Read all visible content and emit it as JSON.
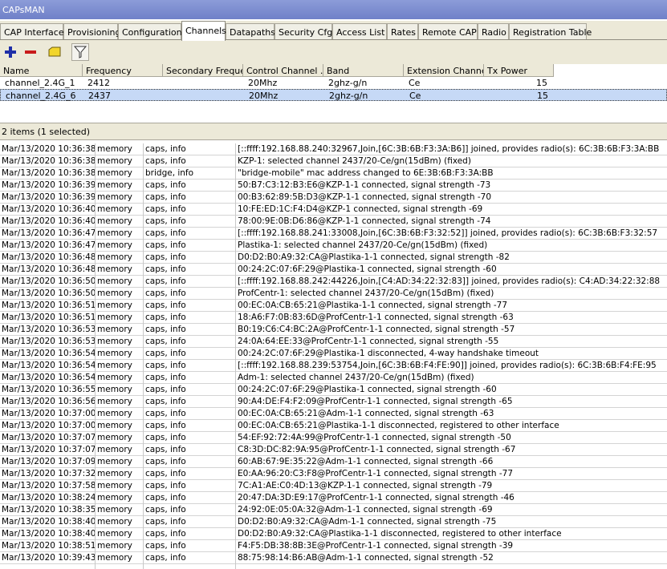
{
  "window": {
    "title": "CAPsMAN"
  },
  "tabs": [
    "CAP Interface",
    "Provisioning",
    "Configurations",
    "Channels",
    "Datapaths",
    "Security Cfg.",
    "Access List",
    "Rates",
    "Remote CAP",
    "Radio",
    "Registration Table"
  ],
  "active_tab": "Channels",
  "toolbar": {
    "buttons": [
      "add-icon",
      "remove-icon",
      "comment-icon",
      "filter-icon"
    ]
  },
  "grid": {
    "columns": [
      "Name",
      "Frequency",
      "Secondary Freque...",
      "Control Channel ...",
      "Band",
      "Extension Channel",
      "Tx Power"
    ],
    "rows": [
      {
        "name": "channel_2.4G_1",
        "frequency": "2412",
        "secondary": "",
        "control": "20Mhz",
        "band": "2ghz-g/n",
        "extension": "Ce",
        "tx_power": "15"
      },
      {
        "name": "channel_2.4G_6",
        "frequency": "2437",
        "secondary": "",
        "control": "20Mhz",
        "band": "2ghz-g/n",
        "extension": "Ce",
        "tx_power": "15"
      }
    ],
    "status": "2 items (1 selected)"
  },
  "log": [
    [
      "Mar/13/2020 10:36:38",
      "memory",
      "caps, info",
      "[::ffff:192.168.88.240:32967,Join,[6C:3B:6B:F3:3A:B6]] joined, provides radio(s): 6C:3B:6B:F3:3A:BB"
    ],
    [
      "Mar/13/2020 10:36:38",
      "memory",
      "caps, info",
      "KZP-1: selected channel 2437/20-Ce/gn(15dBm) (fixed)"
    ],
    [
      "Mar/13/2020 10:36:38",
      "memory",
      "bridge, info",
      "\"bridge-mobile\" mac address changed to 6E:3B:6B:F3:3A:BB"
    ],
    [
      "Mar/13/2020 10:36:39",
      "memory",
      "caps, info",
      "50:B7:C3:12:B3:E6@KZP-1-1 connected, signal strength -73"
    ],
    [
      "Mar/13/2020 10:36:39",
      "memory",
      "caps, info",
      "00:B3:62:89:5B:D3@KZP-1-1 connected, signal strength -70"
    ],
    [
      "Mar/13/2020 10:36:40",
      "memory",
      "caps, info",
      "10:FE:ED:1C:F4:D4@KZP-1 connected, signal strength -69"
    ],
    [
      "Mar/13/2020 10:36:40",
      "memory",
      "caps, info",
      "78:00:9E:0B:D6:86@KZP-1-1 connected, signal strength -74"
    ],
    [
      "Mar/13/2020 10:36:47",
      "memory",
      "caps, info",
      "[::ffff:192.168.88.241:33008,Join,[6C:3B:6B:F3:32:52]] joined, provides radio(s): 6C:3B:6B:F3:32:57"
    ],
    [
      "Mar/13/2020 10:36:47",
      "memory",
      "caps, info",
      "Plastika-1: selected channel 2437/20-Ce/gn(15dBm) (fixed)"
    ],
    [
      "Mar/13/2020 10:36:48",
      "memory",
      "caps, info",
      "D0:D2:B0:A9:32:CA@Plastika-1-1 connected, signal strength -82"
    ],
    [
      "Mar/13/2020 10:36:48",
      "memory",
      "caps, info",
      "00:24:2C:07:6F:29@Plastika-1 connected, signal strength -60"
    ],
    [
      "Mar/13/2020 10:36:50",
      "memory",
      "caps, info",
      "[::ffff:192.168.88.242:44226,Join,[C4:AD:34:22:32:83]] joined, provides radio(s): C4:AD:34:22:32:88"
    ],
    [
      "Mar/13/2020 10:36:50",
      "memory",
      "caps, info",
      "ProfCentr-1: selected channel 2437/20-Ce/gn(15dBm) (fixed)"
    ],
    [
      "Mar/13/2020 10:36:51",
      "memory",
      "caps, info",
      "00:EC:0A:CB:65:21@Plastika-1-1 connected, signal strength -77"
    ],
    [
      "Mar/13/2020 10:36:51",
      "memory",
      "caps, info",
      "18:A6:F7:0B:83:6D@ProfCentr-1-1 connected, signal strength -63"
    ],
    [
      "Mar/13/2020 10:36:53",
      "memory",
      "caps, info",
      "B0:19:C6:C4:BC:2A@ProfCentr-1-1 connected, signal strength -57"
    ],
    [
      "Mar/13/2020 10:36:53",
      "memory",
      "caps, info",
      "24:0A:64:EE:33@ProfCentr-1-1 connected, signal strength -55"
    ],
    [
      "Mar/13/2020 10:36:54",
      "memory",
      "caps, info",
      "00:24:2C:07:6F:29@Plastika-1 disconnected, 4-way handshake timeout"
    ],
    [
      "Mar/13/2020 10:36:54",
      "memory",
      "caps, info",
      "[::ffff:192.168.88.239:53754,Join,[6C:3B:6B:F4:FE:90]] joined, provides radio(s): 6C:3B:6B:F4:FE:95"
    ],
    [
      "Mar/13/2020 10:36:54",
      "memory",
      "caps, info",
      "Adm-1: selected channel 2437/20-Ce/gn(15dBm) (fixed)"
    ],
    [
      "Mar/13/2020 10:36:55",
      "memory",
      "caps, info",
      "00:24:2C:07:6F:29@Plastika-1 connected, signal strength -60"
    ],
    [
      "Mar/13/2020 10:36:56",
      "memory",
      "caps, info",
      "90:A4:DE:F4:F2:09@ProfCentr-1-1 connected, signal strength -65"
    ],
    [
      "Mar/13/2020 10:37:00",
      "memory",
      "caps, info",
      "00:EC:0A:CB:65:21@Adm-1-1 connected, signal strength -63"
    ],
    [
      "Mar/13/2020 10:37:00",
      "memory",
      "caps, info",
      "00:EC:0A:CB:65:21@Plastika-1-1 disconnected, registered to other interface"
    ],
    [
      "Mar/13/2020 10:37:07",
      "memory",
      "caps, info",
      "54:EF:92:72:4A:99@ProfCentr-1-1 connected, signal strength -50"
    ],
    [
      "Mar/13/2020 10:37:07",
      "memory",
      "caps, info",
      "C8:3D:DC:82:9A:95@ProfCentr-1-1 connected, signal strength -67"
    ],
    [
      "Mar/13/2020 10:37:09",
      "memory",
      "caps, info",
      "60:AB:67:9E:35:22@Adm-1-1 connected, signal strength -66"
    ],
    [
      "Mar/13/2020 10:37:32",
      "memory",
      "caps, info",
      "E0:AA:96:20:C3:F8@ProfCentr-1-1 connected, signal strength -77"
    ],
    [
      "Mar/13/2020 10:37:58",
      "memory",
      "caps, info",
      "7C:A1:AE:C0:4D:13@KZP-1-1 connected, signal strength -79"
    ],
    [
      "Mar/13/2020 10:38:24",
      "memory",
      "caps, info",
      "20:47:DA:3D:E9:17@ProfCentr-1-1 connected, signal strength -46"
    ],
    [
      "Mar/13/2020 10:38:35",
      "memory",
      "caps, info",
      "24:92:0E:05:0A:32@Adm-1-1 connected, signal strength -69"
    ],
    [
      "Mar/13/2020 10:38:40",
      "memory",
      "caps, info",
      "D0:D2:B0:A9:32:CA@Adm-1-1 connected, signal strength -75"
    ],
    [
      "Mar/13/2020 10:38:40",
      "memory",
      "caps, info",
      "D0:D2:B0:A9:32:CA@Plastika-1-1 disconnected, registered to other interface"
    ],
    [
      "Mar/13/2020 10:38:51",
      "memory",
      "caps, info",
      "F4:F5:DB:38:8B:3E@ProfCentr-1-1 connected, signal strength -39"
    ],
    [
      "Mar/13/2020 10:39:43",
      "memory",
      "caps, info",
      "88:75:98:14:B6:AB@Adm-1-1 connected, signal strength -52"
    ]
  ],
  "colors": {
    "title_bg": "#7a8bce",
    "selected_row": "#c6d9f6",
    "chrome": "#ece9d8",
    "add": "#1f2fa8",
    "remove": "#c81b1b",
    "comment": "#f2d52a"
  }
}
